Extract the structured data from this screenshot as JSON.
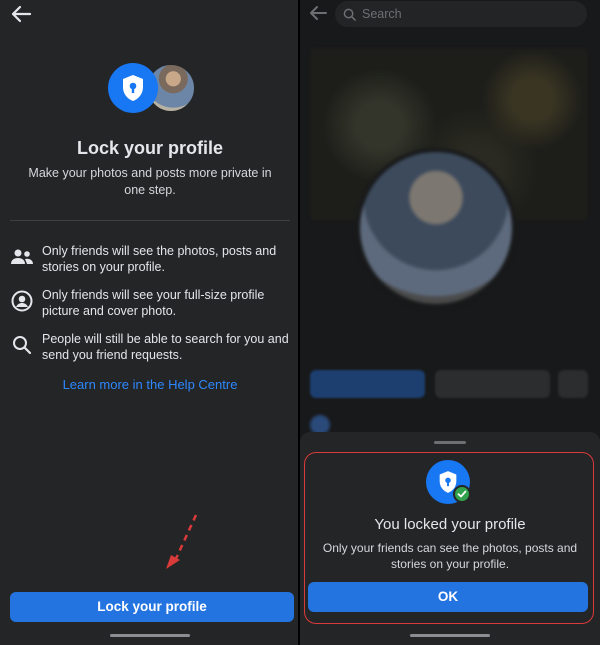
{
  "left": {
    "back_icon": "arrow-left-icon",
    "title": "Lock your profile",
    "subtitle": "Make your photos and posts more private in one step.",
    "bullets": [
      {
        "icon": "friends-icon",
        "text": "Only friends will see the photos, posts and stories on your profile."
      },
      {
        "icon": "profile-circle-icon",
        "text": "Only friends will see your full-size profile picture and cover photo."
      },
      {
        "icon": "search-icon",
        "text": "People will still be able to search for you and send you friend requests."
      }
    ],
    "help_link": "Learn more in the Help Centre",
    "lock_button": "Lock your profile"
  },
  "right": {
    "search_placeholder": "Search",
    "sheet": {
      "title": "You locked your profile",
      "subtitle": "Only your friends can see the photos, posts and stories on your profile.",
      "ok_button": "OK"
    }
  },
  "colors": {
    "accent": "#2374e1",
    "link": "#2d88ff",
    "success": "#31a24c",
    "annotation": "#d93a3a"
  }
}
